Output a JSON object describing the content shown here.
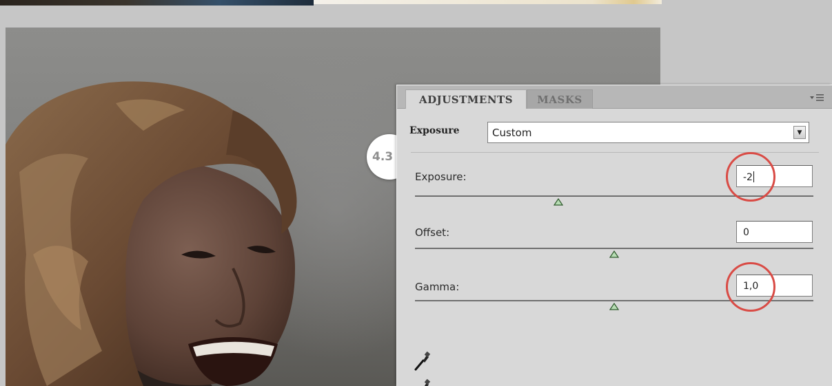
{
  "panel": {
    "tabs": [
      {
        "label": "ADJUSTMENTS",
        "active": true
      },
      {
        "label": "MASKS",
        "active": false
      }
    ],
    "menu_icon": "panel-menu-icon",
    "preset": {
      "label": "Exposure",
      "value": "Custom"
    },
    "controls": [
      {
        "label": "Exposure:",
        "value": "-2",
        "slider_fraction": 0.36,
        "highlighted": true
      },
      {
        "label": "Offset:",
        "value": "0",
        "slider_fraction": 0.5,
        "highlighted": false
      },
      {
        "label": "Gamma:",
        "value": "1,0",
        "slider_fraction": 0.5,
        "highlighted": true
      }
    ],
    "tools": [
      "eyedropper-icon",
      "eyedropper-icon"
    ]
  },
  "callout": {
    "label": "4.3"
  },
  "colors": {
    "highlight_circle": "#d94b45",
    "panel_bg": "#d8d8d8",
    "thumb_fill": "#b7ddb4"
  }
}
